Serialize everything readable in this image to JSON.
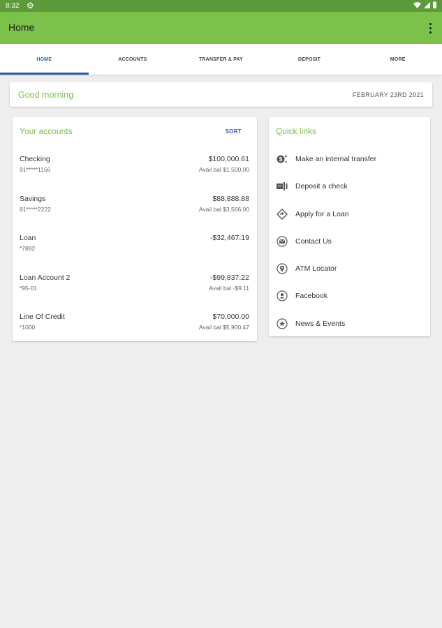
{
  "status_bar": {
    "time": "8:32"
  },
  "app_bar": {
    "title": "Home"
  },
  "tabs": [
    {
      "label": "HOME",
      "active": true
    },
    {
      "label": "ACCOUNTS",
      "active": false
    },
    {
      "label": "TRANSFER & PAY",
      "active": false
    },
    {
      "label": "DEPOSIT",
      "active": false
    },
    {
      "label": "MORE",
      "active": false
    }
  ],
  "greeting": {
    "text": "Good morning",
    "date": "FEBRUARY 23RD 2021"
  },
  "accounts": {
    "title": "Your accounts",
    "sort_label": "SORT",
    "items": [
      {
        "name": "Checking",
        "number": "91*****1156",
        "amount": "$100,000.61",
        "avail": "Avail bal $1,500.00"
      },
      {
        "name": "Savings",
        "number": "81*****2222",
        "amount": "$88,888.88",
        "avail": "Avail bal $3,566.00"
      },
      {
        "name": "Loan",
        "number": "*7892",
        "amount": "-$32,467.19",
        "avail": ""
      },
      {
        "name": "Loan Account 2",
        "number": "*95-01",
        "amount": "-$99,837.22",
        "avail": "Avail bal -$9.11"
      },
      {
        "name": "Line Of Credit",
        "number": "*1000",
        "amount": "$70,000.00",
        "avail": "Avail bal $5,900.47"
      }
    ]
  },
  "quick_links": {
    "title": "Quick links",
    "items": [
      {
        "label": "Make an internal transfer",
        "icon": "transfer-icon"
      },
      {
        "label": "Deposit a check",
        "icon": "check-deposit-icon"
      },
      {
        "label": "Apply for a Loan",
        "icon": "directions-icon"
      },
      {
        "label": "Contact Us",
        "icon": "mail-icon"
      },
      {
        "label": "ATM Locator",
        "icon": "location-pin-icon"
      },
      {
        "label": "Facebook",
        "icon": "person-icon"
      },
      {
        "label": "News & Events",
        "icon": "star-icon"
      }
    ]
  },
  "colors": {
    "primary_green": "#7bc14a",
    "status_green": "#5d9a3a",
    "accent_blue": "#2d5f9a",
    "background": "#eeeeee"
  }
}
